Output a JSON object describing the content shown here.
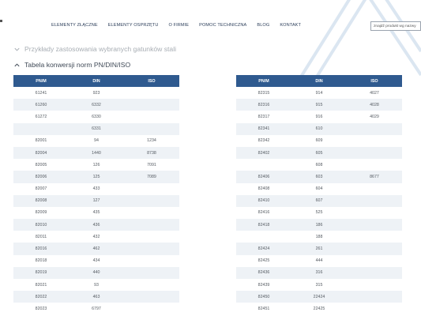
{
  "nav": {
    "items": [
      "ELEMENTY ZŁĄCZNE",
      "ELEMENTY OSPRZĘTU",
      "O FIRMIE",
      "POMOC TECHNICZNA",
      "BLOG",
      "KONTAKT"
    ]
  },
  "search": {
    "placeholder": "znajdź produkt wg nazwy"
  },
  "accordion": {
    "collapsed_title": "Przykłady zastosowania wybranych gatunków stali",
    "expanded_title": "Tabela konwersji norm PN/DIN/ISO"
  },
  "colors": {
    "header_bg": "#2f5a8f",
    "row_alt": "#eef2f6",
    "nav_text": "#2c3e5a"
  },
  "table_left": {
    "headers": [
      "PN/M",
      "DIN",
      "ISO"
    ],
    "rows": [
      [
        "61241",
        "923",
        ""
      ],
      [
        "61260",
        "6332",
        ""
      ],
      [
        "61272",
        "6330",
        ""
      ],
      [
        "",
        "6331",
        ""
      ],
      [
        "82001",
        "94",
        "1234"
      ],
      [
        "82004",
        "1440",
        "8738"
      ],
      [
        "82005",
        "126",
        "7091"
      ],
      [
        "82006",
        "125",
        "7089"
      ],
      [
        "82007",
        "433",
        ""
      ],
      [
        "82008",
        "127",
        ""
      ],
      [
        "82009",
        "435",
        ""
      ],
      [
        "82010",
        "436",
        ""
      ],
      [
        "82011",
        "432",
        ""
      ],
      [
        "82016",
        "462",
        ""
      ],
      [
        "82018",
        "434",
        ""
      ],
      [
        "82019",
        "440",
        ""
      ],
      [
        "82021",
        "93",
        ""
      ],
      [
        "82022",
        "463",
        ""
      ],
      [
        "82023",
        "6797",
        ""
      ]
    ]
  },
  "table_right": {
    "headers": [
      "PN/M",
      "DIN",
      "ISO"
    ],
    "rows": [
      [
        "82315",
        "914",
        "4027"
      ],
      [
        "82316",
        "915",
        "4028"
      ],
      [
        "82317",
        "916",
        "4029"
      ],
      [
        "82341",
        "610",
        ""
      ],
      [
        "82342",
        "609",
        ""
      ],
      [
        "82402",
        "605",
        ""
      ],
      [
        "",
        "608",
        ""
      ],
      [
        "82406",
        "603",
        "8677"
      ],
      [
        "82408",
        "604",
        ""
      ],
      [
        "82410",
        "607",
        ""
      ],
      [
        "82416",
        "525",
        ""
      ],
      [
        "82418",
        "186",
        ""
      ],
      [
        "",
        "188",
        ""
      ],
      [
        "82424",
        "261",
        ""
      ],
      [
        "82425",
        "444",
        ""
      ],
      [
        "82436",
        "316",
        ""
      ],
      [
        "82439",
        "315",
        ""
      ],
      [
        "82450",
        "22424",
        ""
      ],
      [
        "82451",
        "22425",
        ""
      ]
    ]
  }
}
